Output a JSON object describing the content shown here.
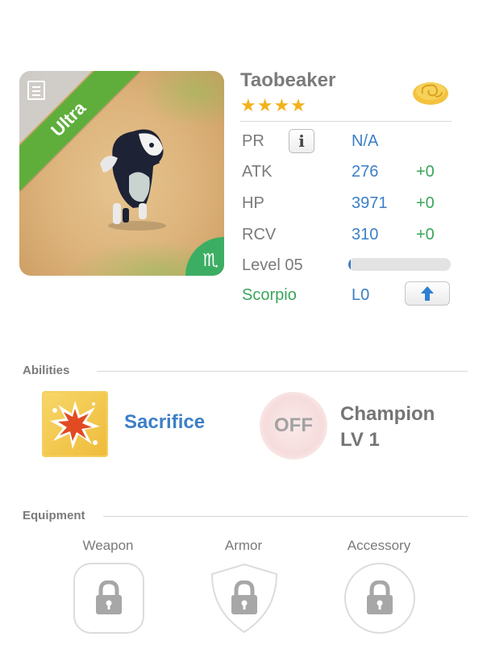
{
  "monster": {
    "name": "Taobeaker",
    "stars": "★★★★",
    "rarity": "Ultra",
    "zodiac_glyph": "♏",
    "zodiac_name": "Scorpio",
    "zodiac_level": "L0"
  },
  "stats": [
    {
      "label": "PR",
      "value": "N/A",
      "bonus": ""
    },
    {
      "label": "ATK",
      "value": "276",
      "bonus": "+0"
    },
    {
      "label": "HP",
      "value": "3971",
      "bonus": "+0"
    },
    {
      "label": "RCV",
      "value": "310",
      "bonus": "+0"
    }
  ],
  "level": {
    "label": "Level 05",
    "progress": 0.02
  },
  "info_button": "i",
  "abilities": {
    "title": "Abilities",
    "skill_name": "Sacrifice",
    "passive_state": "OFF",
    "passive_name_line1": "Champion",
    "passive_name_line2": "LV 1"
  },
  "equipment": {
    "title": "Equipment",
    "slots": [
      {
        "label": "Weapon",
        "icon": "lock-icon"
      },
      {
        "label": "Armor",
        "icon": "lock-icon"
      },
      {
        "label": "Accessory",
        "icon": "lock-icon"
      }
    ]
  },
  "colors": {
    "accent_blue": "#3b7fc8",
    "bonus_green": "#3aa55a",
    "star_gold": "#f2b21c",
    "ultra_green": "#5fae3c"
  }
}
